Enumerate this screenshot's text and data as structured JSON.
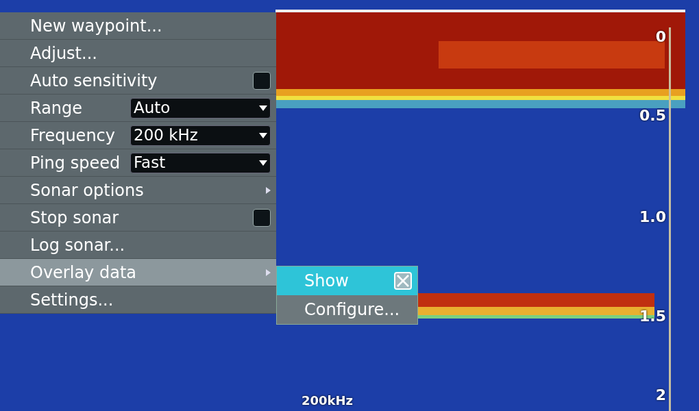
{
  "menu": {
    "items": [
      {
        "label": "New waypoint...",
        "kind": "action",
        "selected": false
      },
      {
        "label": "Adjust...",
        "kind": "action",
        "selected": false
      },
      {
        "label": "Auto sensitivity",
        "kind": "checkbox",
        "checked": false,
        "selected": false
      },
      {
        "label": "Range",
        "kind": "dropdown",
        "value": "Auto",
        "selected": false
      },
      {
        "label": "Frequency",
        "kind": "dropdown",
        "value": "200 kHz",
        "selected": false
      },
      {
        "label": "Ping speed",
        "kind": "dropdown",
        "value": "Fast",
        "selected": false
      },
      {
        "label": "Sonar options",
        "kind": "submenu",
        "selected": false
      },
      {
        "label": "Stop sonar",
        "kind": "checkbox",
        "checked": false,
        "selected": false
      },
      {
        "label": "Log sonar...",
        "kind": "action",
        "selected": false
      },
      {
        "label": "Overlay data",
        "kind": "submenu",
        "selected": true
      },
      {
        "label": "Settings...",
        "kind": "action",
        "selected": false
      }
    ]
  },
  "submenu": {
    "items": [
      {
        "label": "Show",
        "kind": "checkbox",
        "checked": true,
        "selected": true
      },
      {
        "label": "Configure...",
        "kind": "action",
        "selected": false
      }
    ]
  },
  "depth_scale": [
    "0",
    "0.5",
    "1.0",
    "1.5",
    "2"
  ],
  "frequency_label": "200kHz"
}
